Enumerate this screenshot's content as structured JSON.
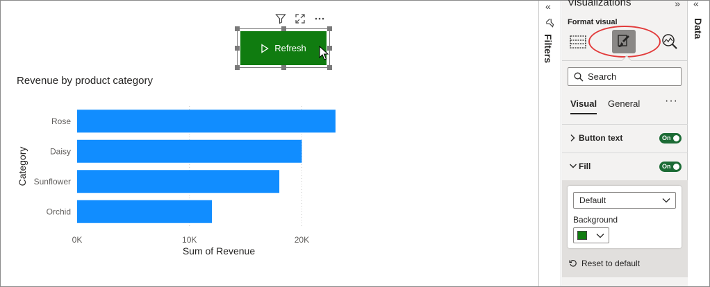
{
  "canvas": {
    "header_icons": [
      "filter-icon",
      "focus-mode-icon",
      "more-options-icon"
    ],
    "refresh_button": {
      "label": "Refresh",
      "color": "#107c10",
      "icon": "play-icon"
    }
  },
  "chart_data": {
    "type": "bar",
    "orientation": "horizontal",
    "title": "Revenue by product category",
    "categories": [
      "Rose",
      "Daisy",
      "Sunflower",
      "Orchid"
    ],
    "values": [
      23000,
      20000,
      18000,
      12000
    ],
    "xlabel": "Sum of Revenue",
    "ylabel": "Category",
    "xlim": [
      0,
      23500
    ],
    "xticks": [
      0,
      10000,
      20000
    ],
    "xtick_labels": [
      "0K",
      "10K",
      "20K"
    ],
    "grid": "vertical-dotted",
    "bar_color": "#118dff"
  },
  "filters_pane": {
    "label": "Filters"
  },
  "viz_pane": {
    "title": "Visualizations",
    "format_label": "Format visual",
    "tools": [
      "fields-icon",
      "format-paintbrush-icon",
      "analytics-icon"
    ],
    "search_placeholder": "Search",
    "tabs": {
      "visual": "Visual",
      "general": "General",
      "more": "···"
    },
    "sections": {
      "button_text": {
        "label": "Button text",
        "toggle": "On"
      },
      "fill": {
        "label": "Fill",
        "toggle": "On"
      }
    },
    "fill_card": {
      "state_value": "Default",
      "background_label": "Background",
      "background_color": "#107c10"
    },
    "reset_label": "Reset to default"
  },
  "data_pane": {
    "label": "Data"
  }
}
